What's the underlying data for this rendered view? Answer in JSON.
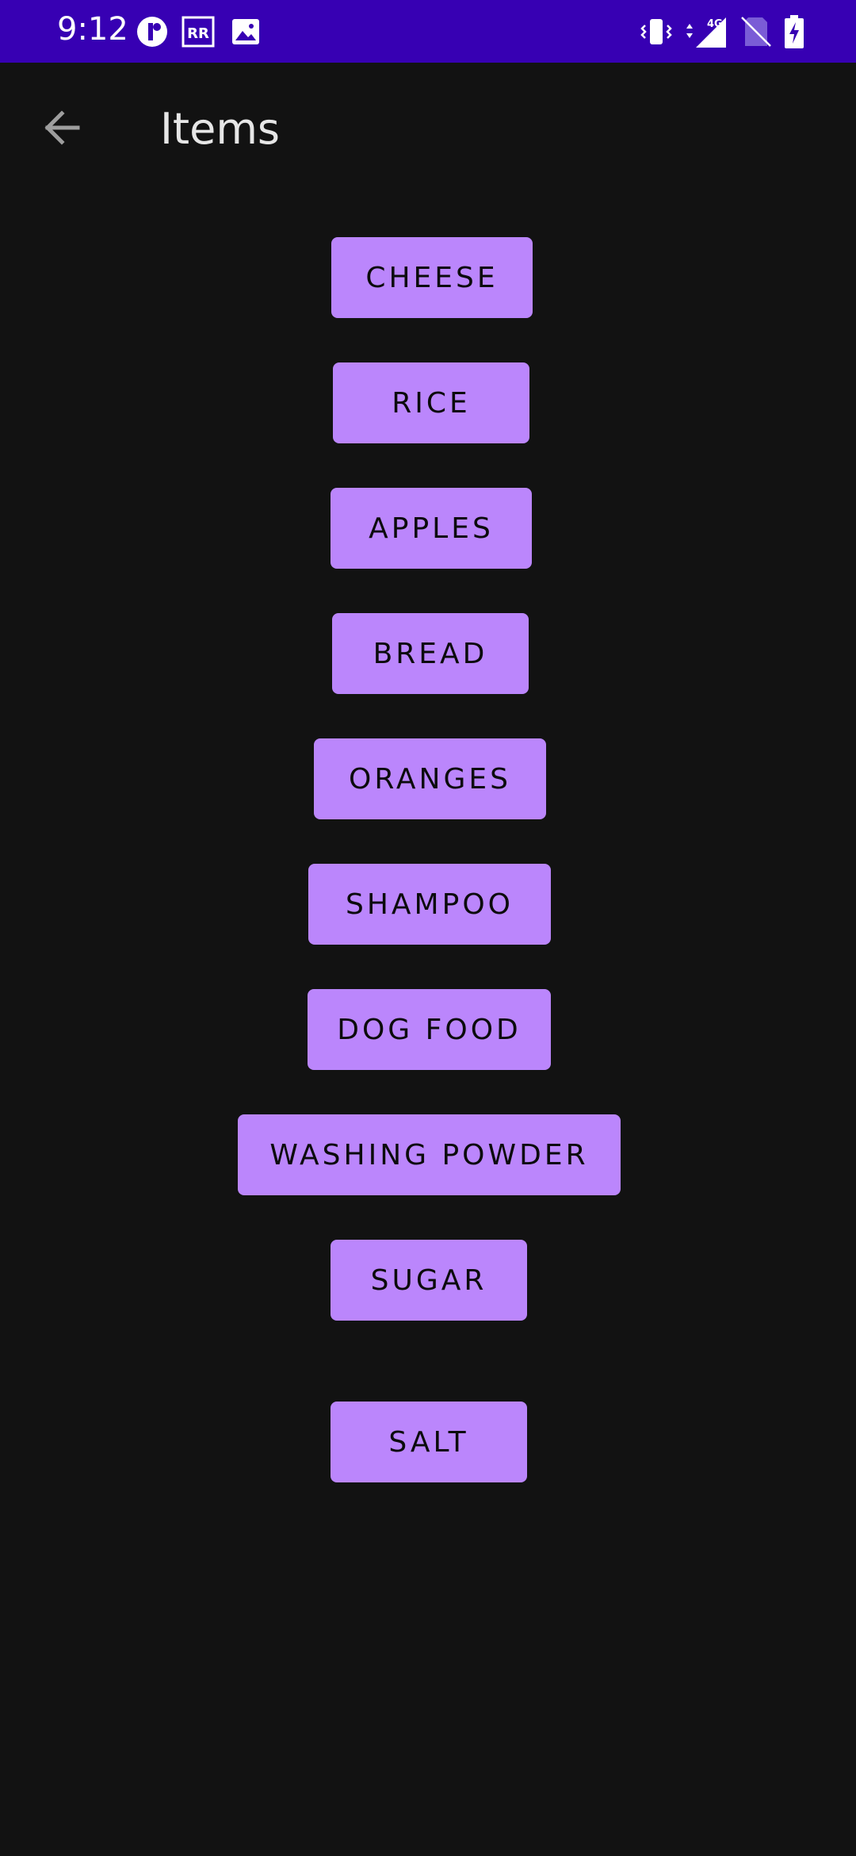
{
  "status_bar": {
    "time": "9:12",
    "background": "#3700b3",
    "icons": [
      "app-notification-icon",
      "rr-icon",
      "image-icon",
      "vibrate-icon",
      "4g-signal-icon",
      "no-sim-icon",
      "battery-charging-icon"
    ],
    "network_label": "4G"
  },
  "app_bar": {
    "title": "Items",
    "back_icon": "arrow-back-icon"
  },
  "accent_color": "#bb86fc",
  "background_color": "#121212",
  "items": [
    {
      "label": "CHEESE"
    },
    {
      "label": "RICE"
    },
    {
      "label": "APPLES"
    },
    {
      "label": "BREAD"
    },
    {
      "label": "ORANGES"
    },
    {
      "label": "SHAMPOO"
    },
    {
      "label": "DOG FOOD"
    },
    {
      "label": "WASHING POWDER"
    },
    {
      "label": "SUGAR"
    },
    {
      "label": "SALT"
    }
  ]
}
